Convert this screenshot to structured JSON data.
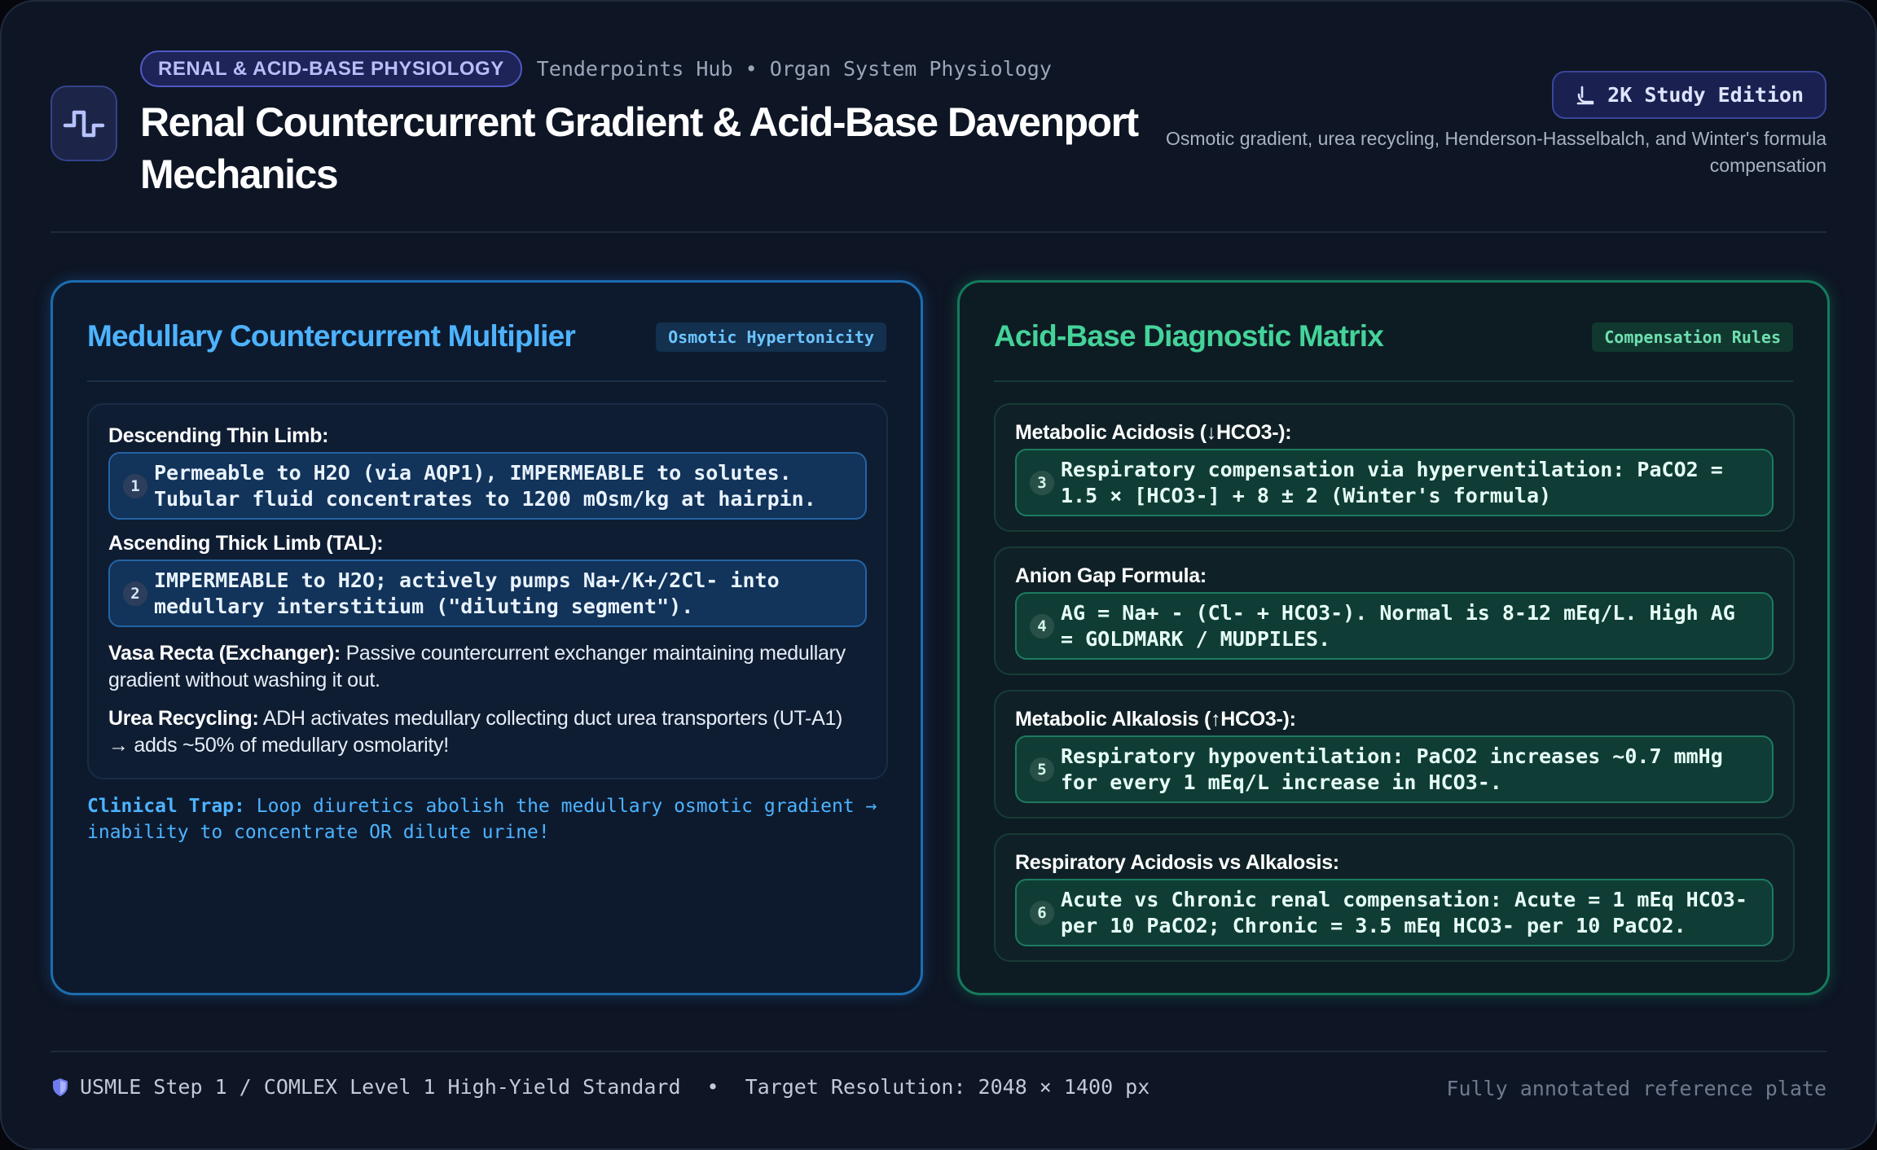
{
  "header": {
    "category": "RENAL & ACID-BASE PHYSIOLOGY",
    "breadcrumb": "Tenderpoints Hub • Organ System Physiology",
    "title": "Renal Countercurrent Gradient & Acid-Base Davenport Mechanics",
    "edition_label": "2K Study Edition",
    "subtitle": "Osmotic gradient, urea recycling, Henderson-Hasselbalch, and Winter's formula compensation",
    "icon": "pulse-wave-icon"
  },
  "left_panel": {
    "title": "Medullary Countercurrent Multiplier",
    "badge": "Osmotic Hypertonicity",
    "items": [
      {
        "heading": "Descending Thin Limb:",
        "number": "1",
        "text": "Permeable to H2O (via AQP1), IMPERMEABLE to solutes. Tubular fluid concentrates to 1200 mOsm/kg at hairpin."
      },
      {
        "heading": "Ascending Thick Limb (TAL):",
        "number": "2",
        "text": "IMPERMEABLE to H2O; actively pumps Na+/K+/2Cl- into medullary interstitium (\"diluting segment\")."
      }
    ],
    "vasa_recta": {
      "label": "Vasa Recta (Exchanger):",
      "text": "Passive countercurrent exchanger maintaining medullary gradient without washing it out."
    },
    "urea": {
      "label": "Urea Recycling:",
      "text": "ADH activates medullary collecting duct urea transporters (UT-A1) → adds ~50% of medullary osmolarity!"
    },
    "trap": {
      "label": "Clinical Trap:",
      "text": "Loop diuretics abolish the medullary osmotic gradient → inability to concentrate OR dilute urine!"
    }
  },
  "right_panel": {
    "title": "Acid-Base Diagnostic Matrix",
    "badge": "Compensation Rules",
    "items": [
      {
        "heading": "Metabolic Acidosis (↓HCO3-):",
        "number": "3",
        "text": "Respiratory compensation via hyperventilation: PaCO2 = 1.5 × [HCO3-] + 8 ± 2 (Winter's formula)"
      },
      {
        "heading": "Anion Gap Formula:",
        "number": "4",
        "text": "AG = Na+ - (Cl- + HCO3-). Normal is 8-12 mEq/L. High AG = GOLDMARK / MUDPILES."
      },
      {
        "heading": "Metabolic Alkalosis (↑HCO3-):",
        "number": "5",
        "text": "Respiratory hypoventilation: PaCO2 increases ~0.7 mmHg for every 1 mEq/L increase in HCO3-."
      },
      {
        "heading": "Respiratory Acidosis vs Alkalosis:",
        "number": "6",
        "text": "Acute vs Chronic renal compensation: Acute = 1 mEq HCO3- per 10 PaCO2; Chronic = 3.5 mEq HCO3- per 10 PaCO2."
      }
    ]
  },
  "footer": {
    "standard": "USMLE Step 1 / COMLEX Level 1 High-Yield Standard",
    "separator": "•",
    "resolution": "Target Resolution: 2048 × 1400 px",
    "note": "Fully annotated reference plate"
  }
}
